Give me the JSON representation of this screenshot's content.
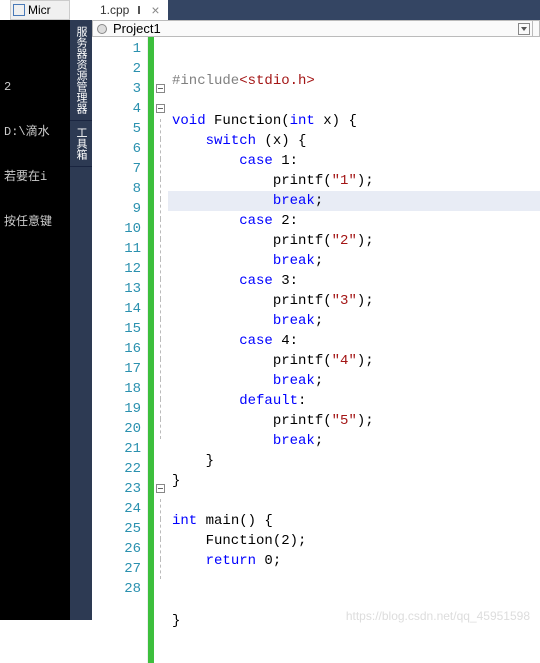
{
  "bg_window_title": "Micr",
  "console": {
    "line1": "",
    "line2": "2",
    "line3": "D:\\滴水",
    "line4": "若要在i",
    "line5": "按任意键"
  },
  "vtabs": {
    "a": "服务器资源管理器",
    "b": "工具箱"
  },
  "tab": {
    "name": "1.cpp",
    "close": "×"
  },
  "nav": {
    "scope": "Project1"
  },
  "code": {
    "lines": [
      {
        "n": 1,
        "fold": "",
        "hl": false,
        "tokens": [
          [
            "pp",
            "#include"
          ],
          [
            "inc",
            "<stdio.h>"
          ]
        ]
      },
      {
        "n": 2,
        "fold": "",
        "hl": false,
        "tokens": []
      },
      {
        "n": 3,
        "fold": "box",
        "hl": false,
        "tokens": [
          [
            "kw",
            "void"
          ],
          [
            "txt",
            " Function("
          ],
          [
            "kw",
            "int"
          ],
          [
            "txt",
            " x) {"
          ]
        ]
      },
      {
        "n": 4,
        "fold": "box",
        "hl": false,
        "tokens": [
          [
            "txt",
            "    "
          ],
          [
            "kw",
            "switch"
          ],
          [
            "txt",
            " (x) {"
          ]
        ]
      },
      {
        "n": 5,
        "fold": "line",
        "hl": false,
        "tokens": [
          [
            "txt",
            "        "
          ],
          [
            "kw",
            "case"
          ],
          [
            "txt",
            " 1:"
          ]
        ]
      },
      {
        "n": 6,
        "fold": "line",
        "hl": false,
        "tokens": [
          [
            "txt",
            "            printf("
          ],
          [
            "str",
            "\"1\""
          ],
          [
            "txt",
            ");"
          ]
        ]
      },
      {
        "n": 7,
        "fold": "line",
        "hl": true,
        "tokens": [
          [
            "txt",
            "            "
          ],
          [
            "kw",
            "break"
          ],
          [
            "txt",
            ";"
          ]
        ]
      },
      {
        "n": 8,
        "fold": "line",
        "hl": false,
        "tokens": [
          [
            "txt",
            "        "
          ],
          [
            "kw",
            "case"
          ],
          [
            "txt",
            " 2:"
          ]
        ]
      },
      {
        "n": 9,
        "fold": "line",
        "hl": false,
        "tokens": [
          [
            "txt",
            "            printf("
          ],
          [
            "str",
            "\"2\""
          ],
          [
            "txt",
            ");"
          ]
        ]
      },
      {
        "n": 10,
        "fold": "line",
        "hl": false,
        "tokens": [
          [
            "txt",
            "            "
          ],
          [
            "kw",
            "break"
          ],
          [
            "txt",
            ";"
          ]
        ]
      },
      {
        "n": 11,
        "fold": "line",
        "hl": false,
        "tokens": [
          [
            "txt",
            "        "
          ],
          [
            "kw",
            "case"
          ],
          [
            "txt",
            " 3:"
          ]
        ]
      },
      {
        "n": 12,
        "fold": "line",
        "hl": false,
        "tokens": [
          [
            "txt",
            "            printf("
          ],
          [
            "str",
            "\"3\""
          ],
          [
            "txt",
            ");"
          ]
        ]
      },
      {
        "n": 13,
        "fold": "line",
        "hl": false,
        "tokens": [
          [
            "txt",
            "            "
          ],
          [
            "kw",
            "break"
          ],
          [
            "txt",
            ";"
          ]
        ]
      },
      {
        "n": 14,
        "fold": "line",
        "hl": false,
        "tokens": [
          [
            "txt",
            "        "
          ],
          [
            "kw",
            "case"
          ],
          [
            "txt",
            " 4:"
          ]
        ]
      },
      {
        "n": 15,
        "fold": "line",
        "hl": false,
        "tokens": [
          [
            "txt",
            "            printf("
          ],
          [
            "str",
            "\"4\""
          ],
          [
            "txt",
            ");"
          ]
        ]
      },
      {
        "n": 16,
        "fold": "line",
        "hl": false,
        "tokens": [
          [
            "txt",
            "            "
          ],
          [
            "kw",
            "break"
          ],
          [
            "txt",
            ";"
          ]
        ]
      },
      {
        "n": 17,
        "fold": "line",
        "hl": false,
        "tokens": [
          [
            "txt",
            "        "
          ],
          [
            "kw",
            "default"
          ],
          [
            "txt",
            ":"
          ]
        ]
      },
      {
        "n": 18,
        "fold": "line",
        "hl": false,
        "tokens": [
          [
            "txt",
            "            printf("
          ],
          [
            "str",
            "\"5\""
          ],
          [
            "txt",
            ");"
          ]
        ]
      },
      {
        "n": 19,
        "fold": "line",
        "hl": false,
        "tokens": [
          [
            "txt",
            "            "
          ],
          [
            "kw",
            "break"
          ],
          [
            "txt",
            ";"
          ]
        ]
      },
      {
        "n": 20,
        "fold": "line",
        "hl": false,
        "tokens": [
          [
            "txt",
            "    }"
          ]
        ]
      },
      {
        "n": 21,
        "fold": "",
        "hl": false,
        "tokens": [
          [
            "txt",
            "}"
          ]
        ]
      },
      {
        "n": 22,
        "fold": "",
        "hl": false,
        "tokens": []
      },
      {
        "n": 23,
        "fold": "box",
        "hl": false,
        "tokens": [
          [
            "kw",
            "int"
          ],
          [
            "txt",
            " main() {"
          ]
        ]
      },
      {
        "n": 24,
        "fold": "line",
        "hl": false,
        "tokens": [
          [
            "txt",
            "    Function(2);"
          ]
        ]
      },
      {
        "n": 25,
        "fold": "line",
        "hl": false,
        "tokens": [
          [
            "txt",
            "    "
          ],
          [
            "kw",
            "return"
          ],
          [
            "txt",
            " 0;"
          ]
        ]
      },
      {
        "n": 26,
        "fold": "line",
        "hl": false,
        "tokens": []
      },
      {
        "n": 27,
        "fold": "line",
        "hl": false,
        "tokens": []
      },
      {
        "n": 28,
        "fold": "",
        "hl": false,
        "tokens": [
          [
            "txt",
            "}"
          ]
        ]
      }
    ]
  },
  "watermark": "https://blog.csdn.net/qq_45951598"
}
